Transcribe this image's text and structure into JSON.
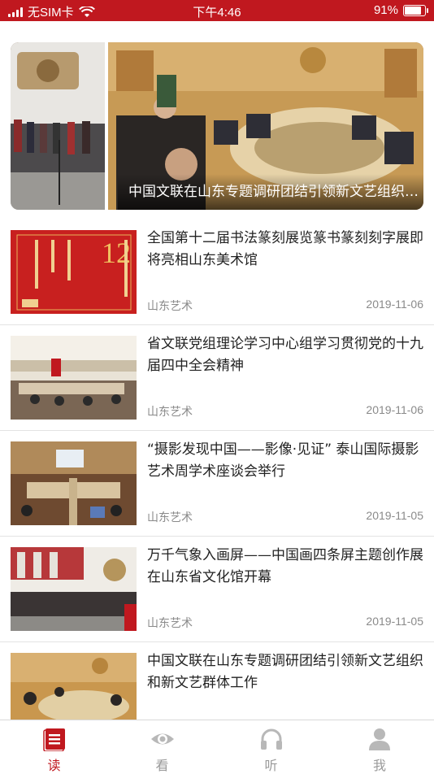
{
  "status_bar": {
    "carrier": "无SIM卡",
    "time": "下午4:46",
    "battery_percent": "91%",
    "battery_level": 0.91
  },
  "featured": {
    "caption": "中国文联在山东专题调研团结引领新文艺组织和新文艺群体工作"
  },
  "news": [
    {
      "title": "全国第十二届书法篆刻展览篆书篆刻刻字展即将亮相山东美术馆",
      "source": "山东艺术",
      "date": "2019-11-06",
      "thumb_text": "12"
    },
    {
      "title": "省文联党组理论学习中心组学习贯彻党的十九届四中全会精神",
      "source": "山东艺术",
      "date": "2019-11-06"
    },
    {
      "title": "“摄影发现中国——影像·见证” 泰山国际摄影艺术周学术座谈会举行",
      "source": "山东艺术",
      "date": "2019-11-05"
    },
    {
      "title": "万千气象入画屏——中国画四条屏主题创作展在山东省文化馆开幕",
      "source": "山东艺术",
      "date": "2019-11-05"
    },
    {
      "title": "中国文联在山东专题调研团结引领新文艺组织和新文艺群体工作",
      "source": "",
      "date": ""
    }
  ],
  "tabs": [
    {
      "label": "读",
      "icon": "book-icon",
      "active": true
    },
    {
      "label": "看",
      "icon": "eye-icon",
      "active": false
    },
    {
      "label": "听",
      "icon": "headphones-icon",
      "active": false
    },
    {
      "label": "我",
      "icon": "person-icon",
      "active": false
    }
  ],
  "colors": {
    "brand_red": "#c0181f",
    "inactive_gray": "#9a9a9a"
  }
}
